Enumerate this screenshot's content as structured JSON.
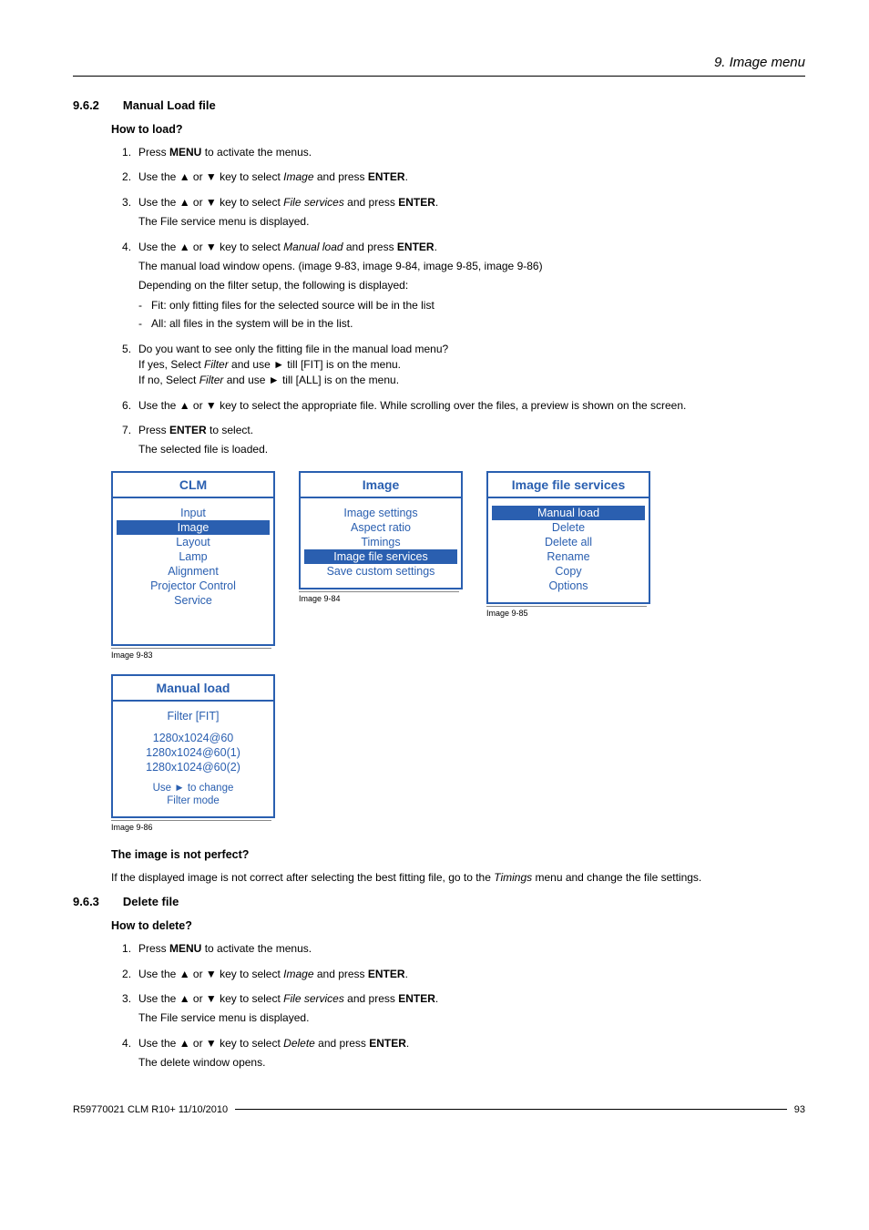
{
  "chapter_header": "9. Image menu",
  "sec_962": {
    "num": "9.6.2",
    "title": "Manual Load file"
  },
  "how_to_load": "How to load?",
  "steps_load": [
    {
      "pre": "Press ",
      "b1": "MENU",
      "post": " to activate the menus."
    },
    {
      "pre": "Use the ▲ or ▼ key to select ",
      "i1": "Image",
      "mid": " and press ",
      "b1": "ENTER",
      "post": "."
    },
    {
      "pre": "Use the ▲ or ▼ key to select ",
      "i1": "File services",
      "mid": " and press ",
      "b1": "ENTER",
      "post": ".",
      "sub": "The File service menu is displayed."
    },
    {
      "pre": "Use the ▲ or ▼ key to select ",
      "i1": "Manual load",
      "mid": " and press ",
      "b1": "ENTER",
      "post": ".",
      "sub": "The manual load window opens. (image 9-83, image 9-84, image 9-85, image 9-86)",
      "sub2": "Depending on the filter setup, the following is displayed:",
      "dash": [
        "Fit: only fitting files for the selected source will be in the list",
        "All: all files in the system will be in the list."
      ]
    },
    {
      "text5a": "Do you want to see only the fitting file in the manual load menu?",
      "text5b_pre": "If yes, Select ",
      "text5b_i": "Filter",
      "text5b_post": " and use ► till [FIT] is on the menu.",
      "text5c_pre": "If no, Select ",
      "text5c_i": "Filter",
      "text5c_post": " and use ► till [ALL] is on the menu."
    },
    {
      "text6": "Use the ▲ or ▼ key to select the appropriate file. While scrolling over the files, a preview is shown on the screen."
    },
    {
      "pre": "Press ",
      "b1": "ENTER",
      "post": " to select.",
      "sub": "The selected file is loaded."
    }
  ],
  "screens": {
    "s83": {
      "title": "CLM",
      "items": [
        "Input",
        "Image",
        "Layout",
        "Lamp",
        "Alignment",
        "Projector Control",
        "Service"
      ],
      "sel": 1,
      "cap": "Image 9-83"
    },
    "s84": {
      "title": "Image",
      "items": [
        "Image settings",
        "Aspect ratio",
        "Timings",
        "Image file services",
        "Save custom settings"
      ],
      "sel": 3,
      "cap": "Image 9-84"
    },
    "s85": {
      "title": "Image file services",
      "items": [
        "Manual load",
        "Delete",
        "Delete all",
        "Rename",
        "Copy",
        "Options"
      ],
      "sel": 0,
      "cap": "Image 9-85"
    },
    "s86": {
      "title": "Manual load",
      "filter": "Filter [FIT]",
      "items": [
        "1280x1024@60",
        "1280x1024@60(1)",
        "1280x1024@60(2)"
      ],
      "hint1": "Use ► to change",
      "hint2": "Filter mode",
      "cap": "Image 9-86"
    }
  },
  "not_perfect_h": "The image is not perfect?",
  "not_perfect_p_pre": "If the displayed image is not correct after selecting the best fitting file, go to the ",
  "not_perfect_p_i": "Timings",
  "not_perfect_p_post": " menu and change the file settings.",
  "sec_963": {
    "num": "9.6.3",
    "title": "Delete file"
  },
  "how_to_delete": "How to delete?",
  "steps_del": [
    {
      "pre": "Press ",
      "b1": "MENU",
      "post": " to activate the menus."
    },
    {
      "pre": "Use the ▲ or ▼ key to select ",
      "i1": "Image",
      "mid": " and press ",
      "b1": "ENTER",
      "post": "."
    },
    {
      "pre": "Use the ▲ or ▼ key to select ",
      "i1": "File services",
      "mid": " and press ",
      "b1": "ENTER",
      "post": ".",
      "sub": "The File service menu is displayed."
    },
    {
      "pre": "Use the ▲ or ▼ key to select ",
      "i1": "Delete",
      "mid": " and press ",
      "b1": "ENTER",
      "post": ".",
      "sub": "The delete window opens."
    }
  ],
  "footer": {
    "left": "R59770021 CLM R10+ 11/10/2010",
    "right": "93"
  }
}
